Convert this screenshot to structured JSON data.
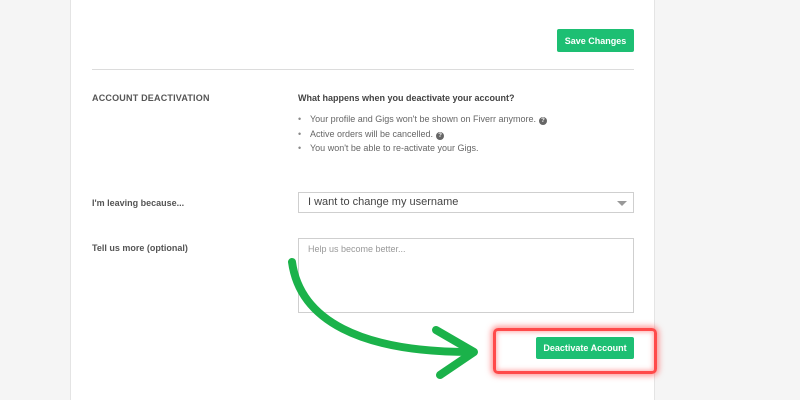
{
  "header": {
    "save_label": "Save Changes"
  },
  "deactivation": {
    "section_title": "ACCOUNT DEACTIVATION",
    "info_heading": "What happens when you deactivate your account?",
    "items": [
      {
        "text": "Your profile and Gigs won't be shown on Fiverr anymore.",
        "has_help_icon": true
      },
      {
        "text": "Active orders will be cancelled.",
        "has_help_icon": true
      },
      {
        "text": "You won't be able to re-activate your Gigs.",
        "has_help_icon": false
      }
    ],
    "help_icon_glyph": "?"
  },
  "form": {
    "reason_label": "I'm leaving because...",
    "reason_selected": "I want to change my username",
    "more_label": "Tell us more (optional)",
    "more_placeholder": "Help us become better...",
    "deactivate_label": "Deactivate Account"
  },
  "annotation": {
    "arrow_color": "#1bb24a",
    "highlight_color": "#ff4a4a"
  },
  "colors": {
    "accent": "#1dbf73",
    "page_bg": "#f5f5f5",
    "panel_bg": "#ffffff"
  }
}
